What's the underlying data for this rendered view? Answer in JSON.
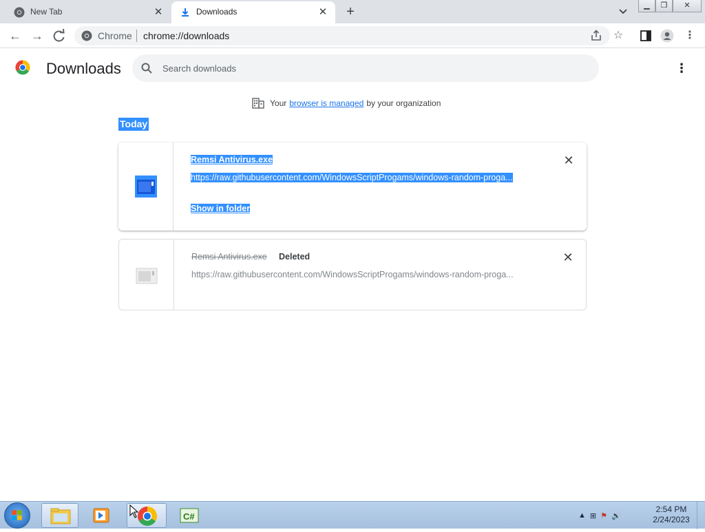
{
  "browser": {
    "tabs": [
      {
        "title": "New Tab",
        "icon": "chrome-icon"
      },
      {
        "title": "Downloads",
        "icon": "download-icon",
        "active": true
      }
    ],
    "new_tab_label": "+",
    "omnibox": {
      "chip": "Chrome",
      "url": "chrome://downloads"
    }
  },
  "page": {
    "title": "Downloads",
    "search_placeholder": "Search downloads",
    "managed_prefix": "Your",
    "managed_link": "browser is managed",
    "managed_suffix": "by your organization",
    "section_header": "Today"
  },
  "downloads": [
    {
      "filename": "Remsi Antivirus.exe",
      "url": "https://raw.githubusercontent.com/WindowsScriptProgams/windows-random-proga...",
      "action": "Show in folder",
      "selected": true
    },
    {
      "filename": "Remsi Antivirus.exe",
      "status": "Deleted",
      "url": "https://raw.githubusercontent.com/WindowsScriptProgams/windows-random-proga..."
    }
  ],
  "taskbar": {
    "time": "2:54 PM",
    "date": "2/24/2023"
  },
  "colors": {
    "selection": "#3390ff",
    "link": "#1a73e8",
    "tabstrip": "#dee1e6"
  }
}
